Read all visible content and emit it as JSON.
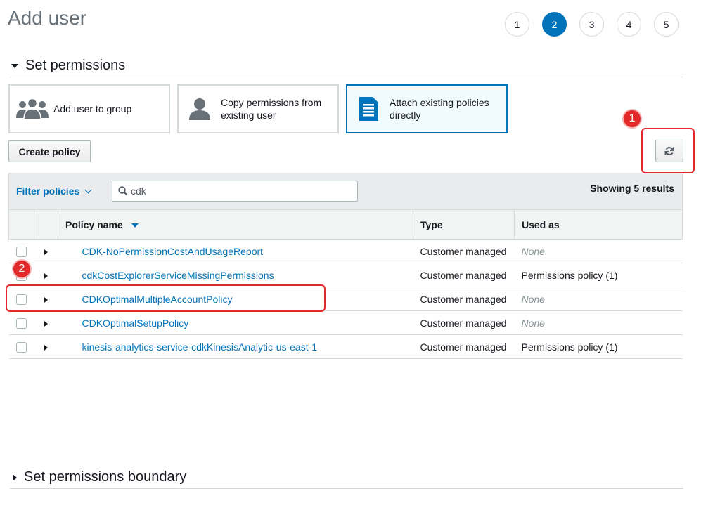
{
  "page": {
    "title": "Add user"
  },
  "wizard": {
    "steps": [
      "1",
      "2",
      "3",
      "4",
      "5"
    ],
    "active_step": "2"
  },
  "permissions": {
    "section_title": "Set permissions",
    "options": [
      {
        "label": "Add user to group",
        "icon": "user-group-icon",
        "selected": false
      },
      {
        "label": "Copy permissions from existing user",
        "icon": "user-icon",
        "selected": false
      },
      {
        "label": "Attach existing policies directly",
        "icon": "document-icon",
        "selected": true
      }
    ],
    "create_policy_label": "Create policy",
    "refresh_icon": "refresh-icon"
  },
  "filter": {
    "label": "Filter policies",
    "search_value": "cdk",
    "results_text": "Showing 5 results"
  },
  "table": {
    "columns": [
      "Policy name",
      "Type",
      "Used as"
    ],
    "sorted_column": "Policy name",
    "rows": [
      {
        "name": "CDK-NoPermissionCostAndUsageReport",
        "type": "Customer managed",
        "used_as": "None"
      },
      {
        "name": "cdkCostExplorerServiceMissingPermissions",
        "type": "Customer managed",
        "used_as": "Permissions policy (1)"
      },
      {
        "name": "CDKOptimalMultipleAccountPolicy",
        "type": "Customer managed",
        "used_as": "None"
      },
      {
        "name": "CDKOptimalSetupPolicy",
        "type": "Customer managed",
        "used_as": "None"
      },
      {
        "name": "kinesis-analytics-service-cdkKinesisAnalytic-us-east-1",
        "type": "Customer managed",
        "used_as": "Permissions policy (1)"
      }
    ]
  },
  "annotations": {
    "badge_1": "1",
    "badge_2": "2"
  },
  "boundary": {
    "section_title": "Set permissions boundary"
  },
  "colors": {
    "accent": "#0073bb",
    "annotation": "#e22929"
  }
}
